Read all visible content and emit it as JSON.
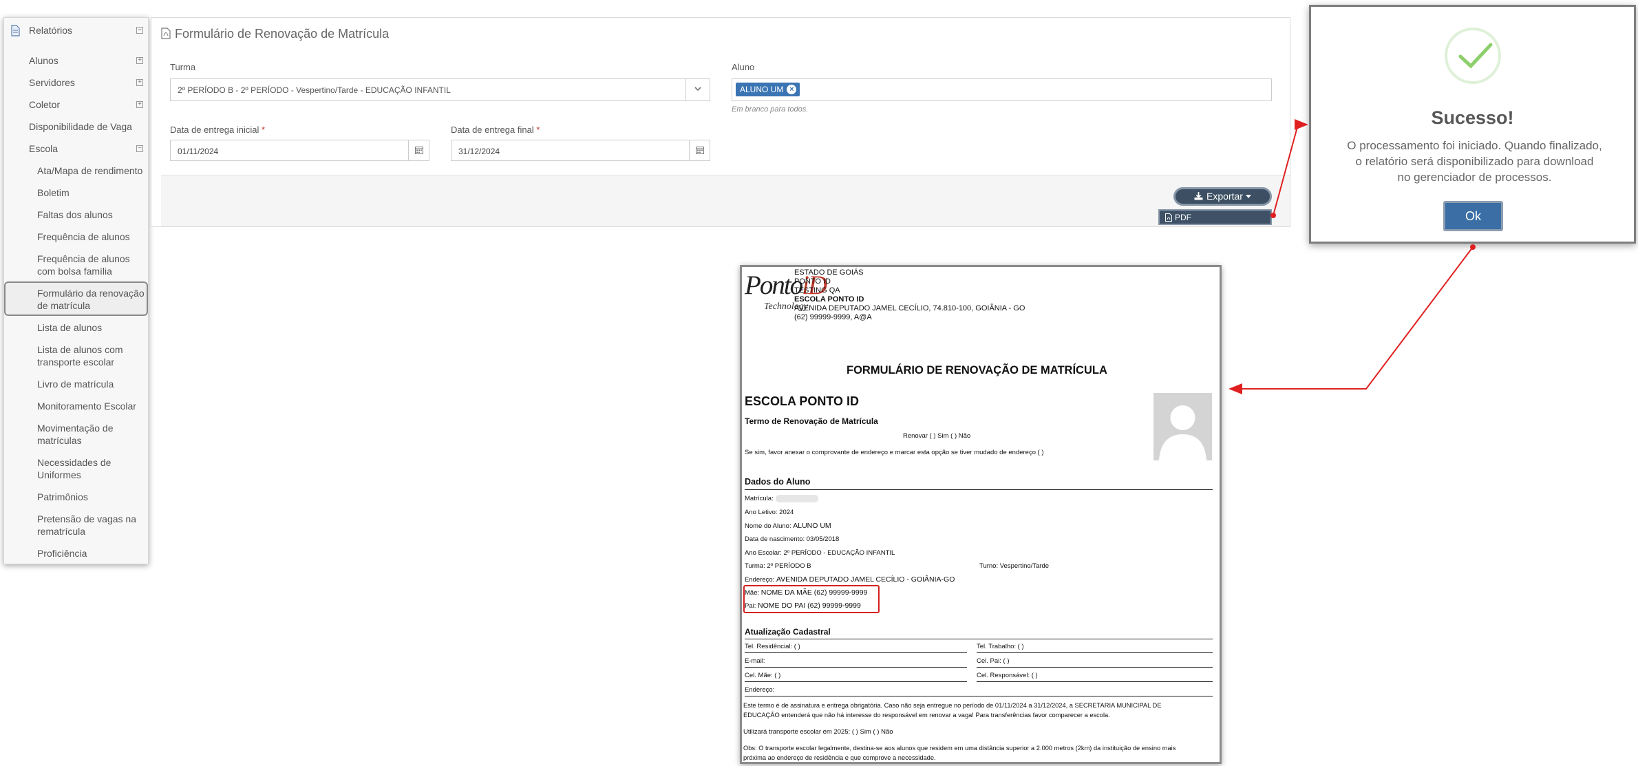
{
  "sidebar": {
    "header": "Relatórios",
    "items": [
      {
        "label": "Alunos",
        "collapsible": true
      },
      {
        "label": "Servidores",
        "collapsible": true
      },
      {
        "label": "Coletor",
        "collapsible": true
      },
      {
        "label": "Disponibilidade de Vaga",
        "collapsible": false
      },
      {
        "label": "Escola",
        "collapsible": true
      }
    ],
    "subitems": [
      {
        "line1": "Ata/Mapa de rendimento",
        "line2": ""
      },
      {
        "line1": "Boletim",
        "line2": ""
      },
      {
        "line1": "Faltas dos alunos",
        "line2": ""
      },
      {
        "line1": "Frequência de alunos",
        "line2": ""
      },
      {
        "line1": "Frequência de alunos",
        "line2": "com bolsa família"
      },
      {
        "line1": "Formulário da renovação",
        "line2": "de matrícula",
        "active": true
      },
      {
        "line1": "Lista de alunos",
        "line2": ""
      },
      {
        "line1": "Lista de alunos com",
        "line2": "transporte escolar"
      },
      {
        "line1": "Livro de matrícula",
        "line2": ""
      },
      {
        "line1": "Monitoramento Escolar",
        "line2": ""
      },
      {
        "line1": "Movimentação de",
        "line2": "matrículas"
      },
      {
        "line1": "Necessidades de",
        "line2": "Uniformes"
      },
      {
        "line1": "Patrimônios",
        "line2": ""
      },
      {
        "line1": "Pretensão de vagas na",
        "line2": "rematrícula"
      },
      {
        "line1": "Proficiência",
        "line2": ""
      }
    ]
  },
  "form": {
    "title": "Formulário de Renovação de Matrícula",
    "turma_label": "Turma",
    "turma_value": "2º PERÍODO B - 2º PERÍODO - Vespertino/Tarde - EDUCAÇÃO INFANTIL",
    "aluno_label": "Aluno",
    "aluno_tag": "ALUNO UM",
    "aluno_hint": "Em branco para todos.",
    "data_inicial_label": "Data de entrega inicial",
    "data_inicial_value": "01/11/2024",
    "data_final_label": "Data de entrega final",
    "data_final_value": "31/12/2024",
    "required_mark": "*",
    "export_label": "Exportar",
    "pdf_option": "PDF"
  },
  "dialog": {
    "title": "Sucesso!",
    "message_1": "O processamento foi iniciado. Quando finalizado,",
    "message_2": "o relatório será disponibilizado para download",
    "message_3": "no gerenciador de processos.",
    "ok_label": "Ok"
  },
  "report": {
    "logo_main": "Ponto",
    "logo_id": "iD",
    "logo_sub": "Technology",
    "header_lines": [
      "ESTADO DE GOIÁS",
      "PONTO ID",
      "TESTING QA",
      "ESCOLA PONTO ID",
      "AVENIDA DEPUTADO JAMEL CECÍLIO, 74.810-100, GOIÂNIA - GO",
      "(62) 99999-9999, A@A"
    ],
    "title": "FORMULÁRIO DE RENOVAÇÃO DE MATRÍCULA",
    "school": "ESCOLA PONTO ID",
    "termo_title": "Termo de Renovação de Matrícula",
    "renovar": "Renovar (    ) Sim    (    ) Não",
    "endereco_note": "Se sim, favor anexar o comprovante de endereço e marcar esta opção se tiver mudado de endereço (    )",
    "dados_title": "Dados do Aluno",
    "matricula": "Matrícula:",
    "ano_letivo": "Ano Letivo: 2024",
    "nome_label": "Nome do Aluno:",
    "nome_value": "ALUNO UM",
    "nascimento": "Data de nascimento: 03/05/2018",
    "ano_escolar": "Ano Escolar: 2º PERÍODO - EDUCAÇÃO INFANTIL",
    "turma": "Turma: 2º PERÍODO B",
    "turno": "Turno: Vespertino/Tarde",
    "endereco_label": "Endereço:",
    "endereco_value": "AVENIDA DEPUTADO JAMEL CECÍLIO - GOIÂNIA-GO",
    "mae_label": "Mãe:",
    "mae_value": "NOME DA MÃE (62) 99999-9999",
    "pai_label": "Pai:",
    "pai_value": "NOME DO PAI (62) 99999-9999",
    "atualizacao_title": "Atualização Cadastral",
    "tel_res": "Tel. Residêncial: (    )",
    "tel_trab": "Tel. Trabalho: (    )",
    "email": "E-mail:",
    "cel_pai": "Cel. Pai: (    )",
    "cel_mae": "Cel. Mãe: (    )",
    "cel_resp": "Cel. Responsável: (    )",
    "endereco2": "Endereço:",
    "termo_text_1": "Este termo é de assinatura e entrega obrigatória. Caso não seja entregue no período de 01/11/2024 a 31/12/2024, a SECRETARIA MUNICIPAL DE",
    "termo_text_2": "EDUCAÇÃO entenderá que não há interesse do responsável em renovar a vaga! Para transferências favor comparecer a escola.",
    "transporte": "Utilizará transporte escolar em 2025: (    ) Sim    (    ) Não",
    "obs_1": "Obs: O transporte escolar legalmente, destina-se aos alunos que residem em uma distância superior a 2.000 metros (2km) da instituição de ensino mais",
    "obs_2": "próxima ao endereço de residência e que comprove a necessidade."
  },
  "colors": {
    "primary": "#3a6ea5",
    "export_btn": "#3c4f63",
    "success": "#8ccf6b",
    "arrow": "#e02020"
  }
}
